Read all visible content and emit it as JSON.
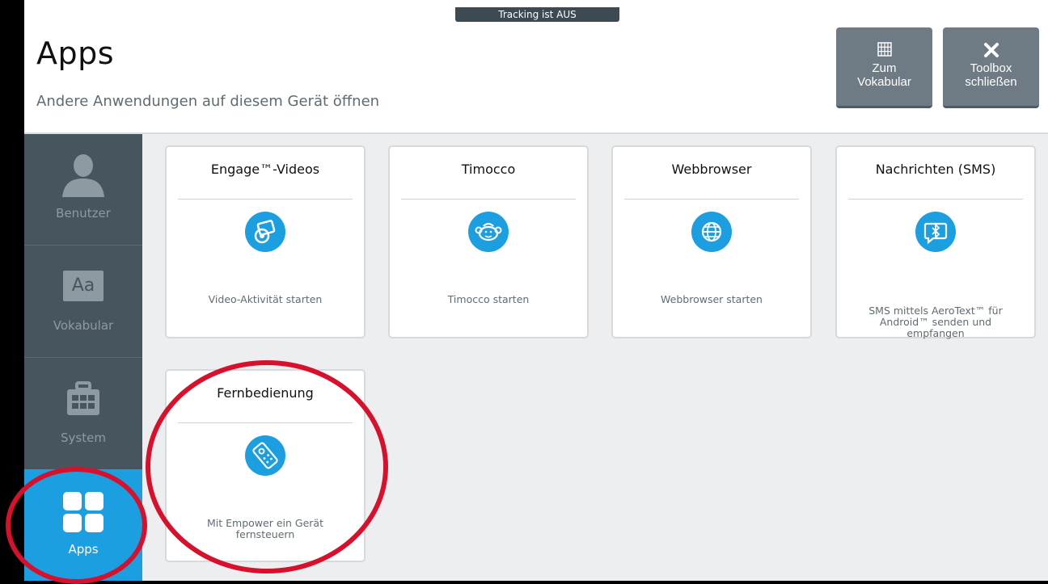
{
  "tracking_status": "Tracking ist AUS",
  "header": {
    "title": "Apps",
    "subtitle": "Andere Anwendungen auf diesem Gerät öffnen",
    "buttons": {
      "vocab_line1": "Zum",
      "vocab_line2": "Vokabular",
      "close_line1": "Toolbox",
      "close_line2": "schließen"
    }
  },
  "sidebar": {
    "items": [
      {
        "label": "Benutzer",
        "icon": "user-icon"
      },
      {
        "label": "Vokabular",
        "icon": "vocabulary-icon",
        "icon_text": "Aa"
      },
      {
        "label": "System",
        "icon": "toolbox-icon"
      },
      {
        "label": "Apps",
        "icon": "apps-grid-icon",
        "active": true
      }
    ]
  },
  "apps": [
    {
      "title": "Engage™-Videos",
      "description": "Video-Aktivität starten",
      "icon": "video-activity-icon"
    },
    {
      "title": "Timocco",
      "description": "Timocco starten",
      "icon": "timocco-monkey-icon"
    },
    {
      "title": "Webbrowser",
      "description": "Webbrowser starten",
      "icon": "globe-icon"
    },
    {
      "title": "Nachrichten (SMS)",
      "description": "SMS mittels AeroText™ für Android™ senden und empfangen",
      "icon": "bluetooth-message-icon"
    },
    {
      "title": "Fernbedienung",
      "description": "Mit Empower ein Gerät fernsteuern",
      "icon": "remote-control-icon"
    }
  ],
  "colors": {
    "accent": "#1b9fe0",
    "sidebar": "#47555e",
    "annotation": "#d8102c"
  }
}
